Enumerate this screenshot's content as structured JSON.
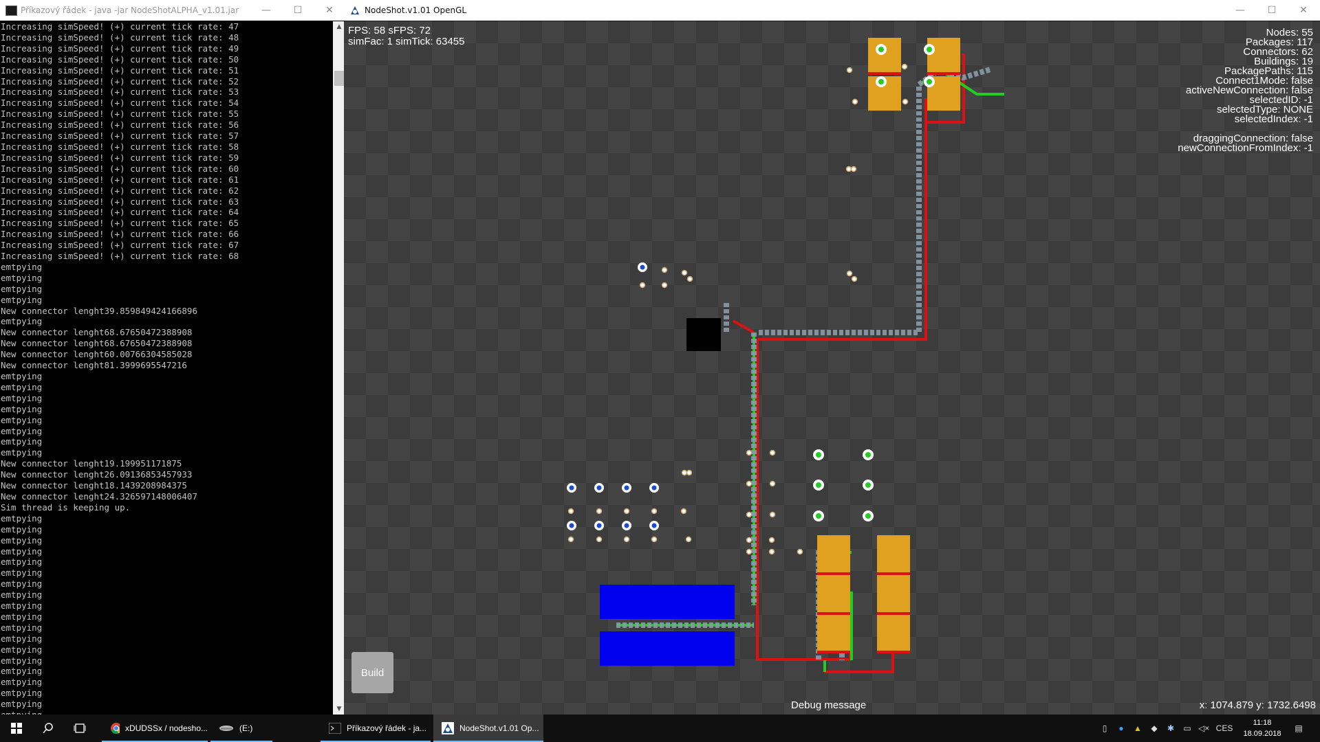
{
  "console": {
    "title": "Příkazový řádek - java  -jar NodeShotALPHA_v1.01.jar",
    "lines": [
      "Increasing simSpeed! (+) current tick rate: 47",
      "Increasing simSpeed! (+) current tick rate: 48",
      "Increasing simSpeed! (+) current tick rate: 49",
      "Increasing simSpeed! (+) current tick rate: 50",
      "Increasing simSpeed! (+) current tick rate: 51",
      "Increasing simSpeed! (+) current tick rate: 52",
      "Increasing simSpeed! (+) current tick rate: 53",
      "Increasing simSpeed! (+) current tick rate: 54",
      "Increasing simSpeed! (+) current tick rate: 55",
      "Increasing simSpeed! (+) current tick rate: 56",
      "Increasing simSpeed! (+) current tick rate: 57",
      "Increasing simSpeed! (+) current tick rate: 58",
      "Increasing simSpeed! (+) current tick rate: 59",
      "Increasing simSpeed! (+) current tick rate: 60",
      "Increasing simSpeed! (+) current tick rate: 61",
      "Increasing simSpeed! (+) current tick rate: 62",
      "Increasing simSpeed! (+) current tick rate: 63",
      "Increasing simSpeed! (+) current tick rate: 64",
      "Increasing simSpeed! (+) current tick rate: 65",
      "Increasing simSpeed! (+) current tick rate: 66",
      "Increasing simSpeed! (+) current tick rate: 67",
      "Increasing simSpeed! (+) current tick rate: 68",
      "emtpying",
      "emtpying",
      "emtpying",
      "emtpying",
      "New connector lenght39.859849424166896",
      "emtpying",
      "New connector lenght68.67650472388908",
      "New connector lenght68.67650472388908",
      "New connector lenght60.00766304585028",
      "New connector lenght81.3999695547216",
      "emtpying",
      "emtpying",
      "emtpying",
      "emtpying",
      "emtpying",
      "emtpying",
      "emtpying",
      "emtpying",
      "New connector lenght19.199951171875",
      "New connector lenght26.09136853457933",
      "New connector lenght18.1439208984375",
      "New connector lenght24.326597148006407",
      "Sim thread is keeping up.",
      "emtpying",
      "emtpying",
      "emtpying",
      "emtpying",
      "emtpying",
      "emtpying",
      "emtpying",
      "emtpying",
      "emtpying",
      "emtpying",
      "emtpying",
      "emtpying",
      "emtpying",
      "emtpying",
      "emtpying",
      "emtpying",
      "emtpying",
      "emtpying",
      "emtpying"
    ]
  },
  "game": {
    "title": "NodeShot.v1.01 OpenGL",
    "hud_left": [
      "FPS: 58 sFPS: 72",
      "simFac: 1 simTick: 63455"
    ],
    "hud_right": [
      "Nodes: 55",
      "Packages: 117",
      "Connectors: 62",
      "Buildings: 19",
      "PackagePaths: 115",
      "Connect1Mode: false",
      "activeNewConnection: false",
      "selectedID: -1",
      "selectedType: NONE",
      "selectedIndex: -1",
      "",
      "draggingConnection: false",
      "newConnectionFromIndex: -1"
    ],
    "build_label": "Build",
    "debug_message": "Debug message",
    "coords": "x: 1074.879 y: 1732.6498",
    "colors": {
      "building_orange": "#e0a020",
      "building_blue": "#0000ee",
      "wire_red": "#dd1111",
      "wire_green": "#22cc22",
      "package_gray": "#8a9aa8"
    }
  },
  "window_controls": {
    "minimize": "—",
    "maximize": "☐",
    "close": "✕"
  },
  "taskbar": {
    "apps": [
      {
        "label": "xDUDSSx / nodesho...",
        "icon": "chrome-icon"
      },
      {
        "label": "(E:)",
        "icon": "drive-icon"
      },
      {
        "label": "Příkazový řádek - ja...",
        "icon": "cmd-icon"
      },
      {
        "label": "NodeShot.v1.01 Op...",
        "icon": "nodeshot-icon"
      }
    ],
    "language": "CES",
    "time": "11:18",
    "date": "18.09.2018"
  }
}
